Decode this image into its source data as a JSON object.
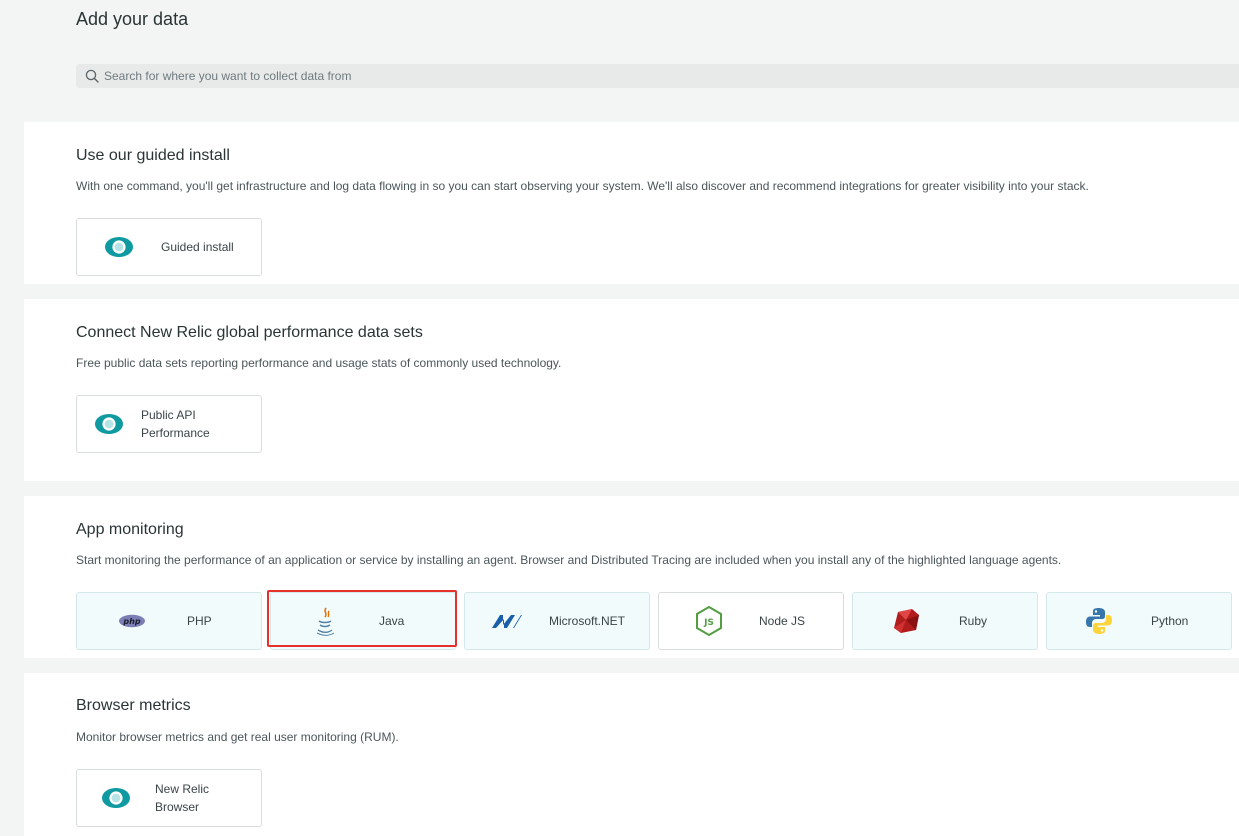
{
  "page": {
    "title": "Add your data"
  },
  "search": {
    "placeholder": "Search for where you want to collect data from",
    "value": ""
  },
  "sections": {
    "guided": {
      "title": "Use our guided install",
      "description": "With one command, you'll get infrastructure and log data flowing in so you can start observing your system. We'll also discover and recommend integrations for greater visibility into your stack.",
      "tiles": [
        {
          "label": "Guided install",
          "icon": "new-relic-eye-icon"
        }
      ]
    },
    "datasets": {
      "title": "Connect New Relic global performance data sets",
      "description": "Free public data sets reporting performance and usage stats of commonly used technology.",
      "tiles": [
        {
          "label_line1": "Public API",
          "label_line2": "Performance",
          "icon": "new-relic-eye-icon"
        }
      ]
    },
    "app": {
      "title": "App monitoring",
      "description": "Start monitoring the performance of an application or service by installing an agent. Browser and Distributed Tracing are included when you install any of the highlighted language agents.",
      "tiles": [
        {
          "label": "PHP",
          "icon": "php-icon",
          "highlighted": true
        },
        {
          "label": "Java",
          "icon": "java-icon",
          "highlighted": true,
          "selected": true
        },
        {
          "label": "Microsoft.NET",
          "icon": "dotnet-icon",
          "highlighted": true
        },
        {
          "label": "Node JS",
          "icon": "nodejs-icon",
          "highlighted": false
        },
        {
          "label": "Ruby",
          "icon": "ruby-icon",
          "highlighted": true
        },
        {
          "label": "Python",
          "icon": "python-icon",
          "highlighted": true
        }
      ]
    },
    "browser": {
      "title": "Browser metrics",
      "description": "Monitor browser metrics and get real user monitoring (RUM).",
      "tiles": [
        {
          "label_line1": "New Relic",
          "label_line2": "Browser",
          "icon": "new-relic-eye-icon"
        }
      ]
    }
  },
  "colors": {
    "accent_teal": "#0f9aa1",
    "selection_red": "#e5302b",
    "highlight_tile": "#f1fbfc"
  }
}
